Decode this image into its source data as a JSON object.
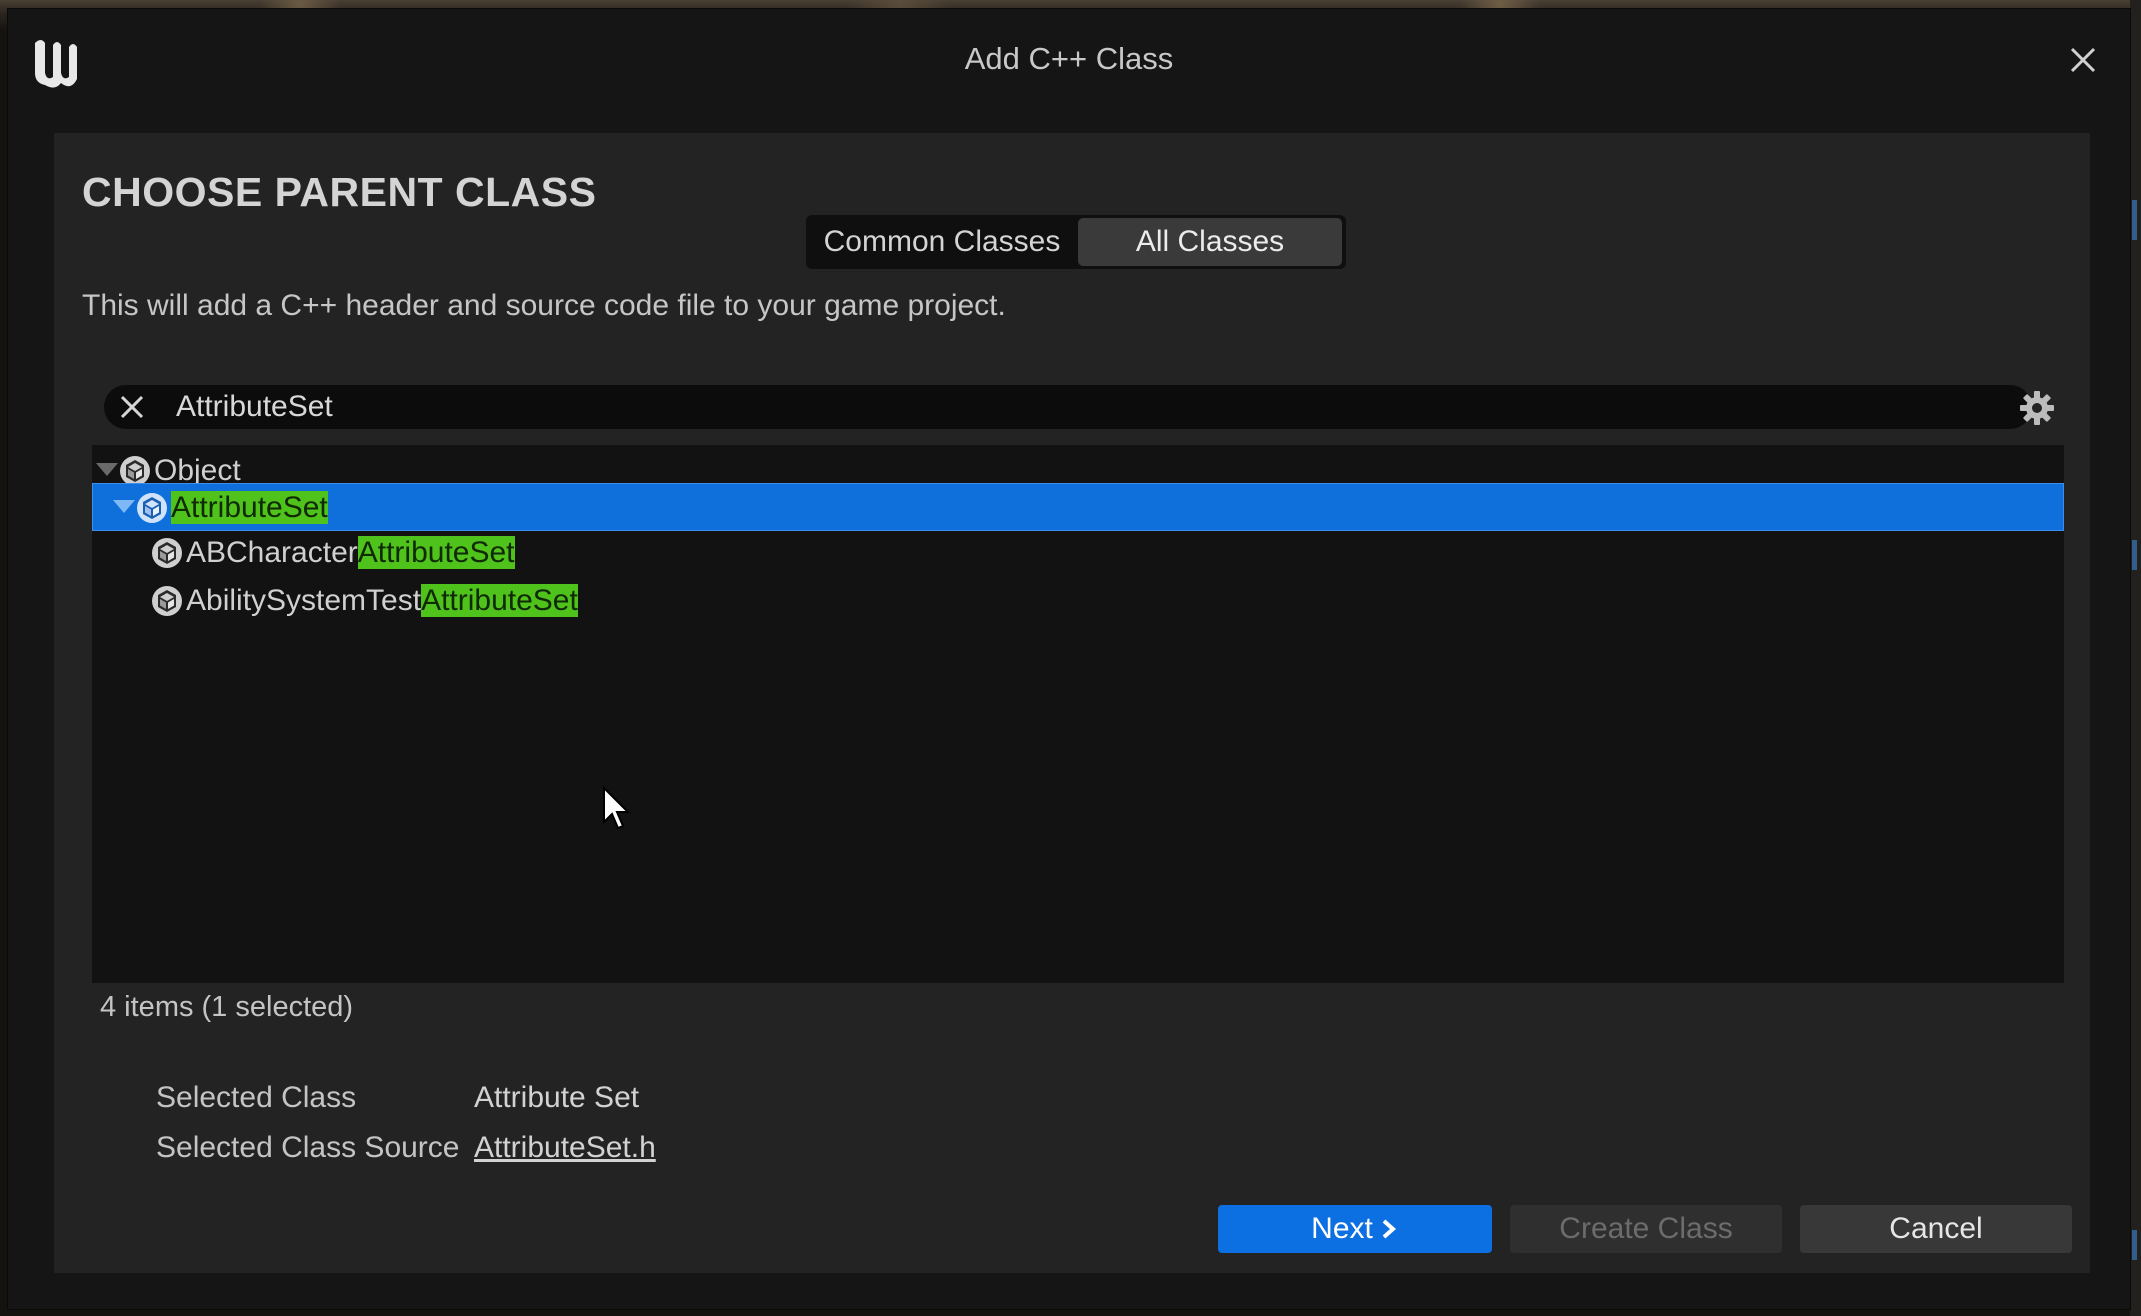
{
  "window": {
    "title": "Add C++ Class",
    "close_icon": "close-icon",
    "logo_icon": "unreal-logo-icon"
  },
  "panel": {
    "heading": "CHOOSE PARENT CLASS",
    "tabs": [
      {
        "label": "Common Classes",
        "active": false
      },
      {
        "label": "All Classes",
        "active": true
      }
    ],
    "description": "This will add a C++ header and source code file to your game project."
  },
  "search": {
    "value": "AttributeSet",
    "clear_icon": "close-icon",
    "settings_icon": "gear-icon"
  },
  "tree": {
    "rows": [
      {
        "label_plain": "Object",
        "label_highlight": "",
        "expanded": true,
        "selected": false
      },
      {
        "label_plain": "",
        "label_highlight": "AttributeSet",
        "expanded": true,
        "selected": true
      },
      {
        "label_plain": "ABCharacter",
        "label_highlight": "AttributeSet",
        "expanded": false,
        "selected": false
      },
      {
        "label_plain": "AbilitySystemTest",
        "label_highlight": "AttributeSet",
        "expanded": false,
        "selected": false
      }
    ],
    "status": "4 items (1 selected)"
  },
  "selected_info": {
    "class_key": "Selected Class",
    "class_value": "Attribute Set",
    "source_key": "Selected Class Source",
    "source_value": "AttributeSet.h"
  },
  "buttons": {
    "next": "Next",
    "create": "Create Class",
    "cancel": "Cancel"
  },
  "colors": {
    "accent": "#0d70e2",
    "highlight": "#4fc21b",
    "panel": "#232323",
    "list": "#121212"
  }
}
